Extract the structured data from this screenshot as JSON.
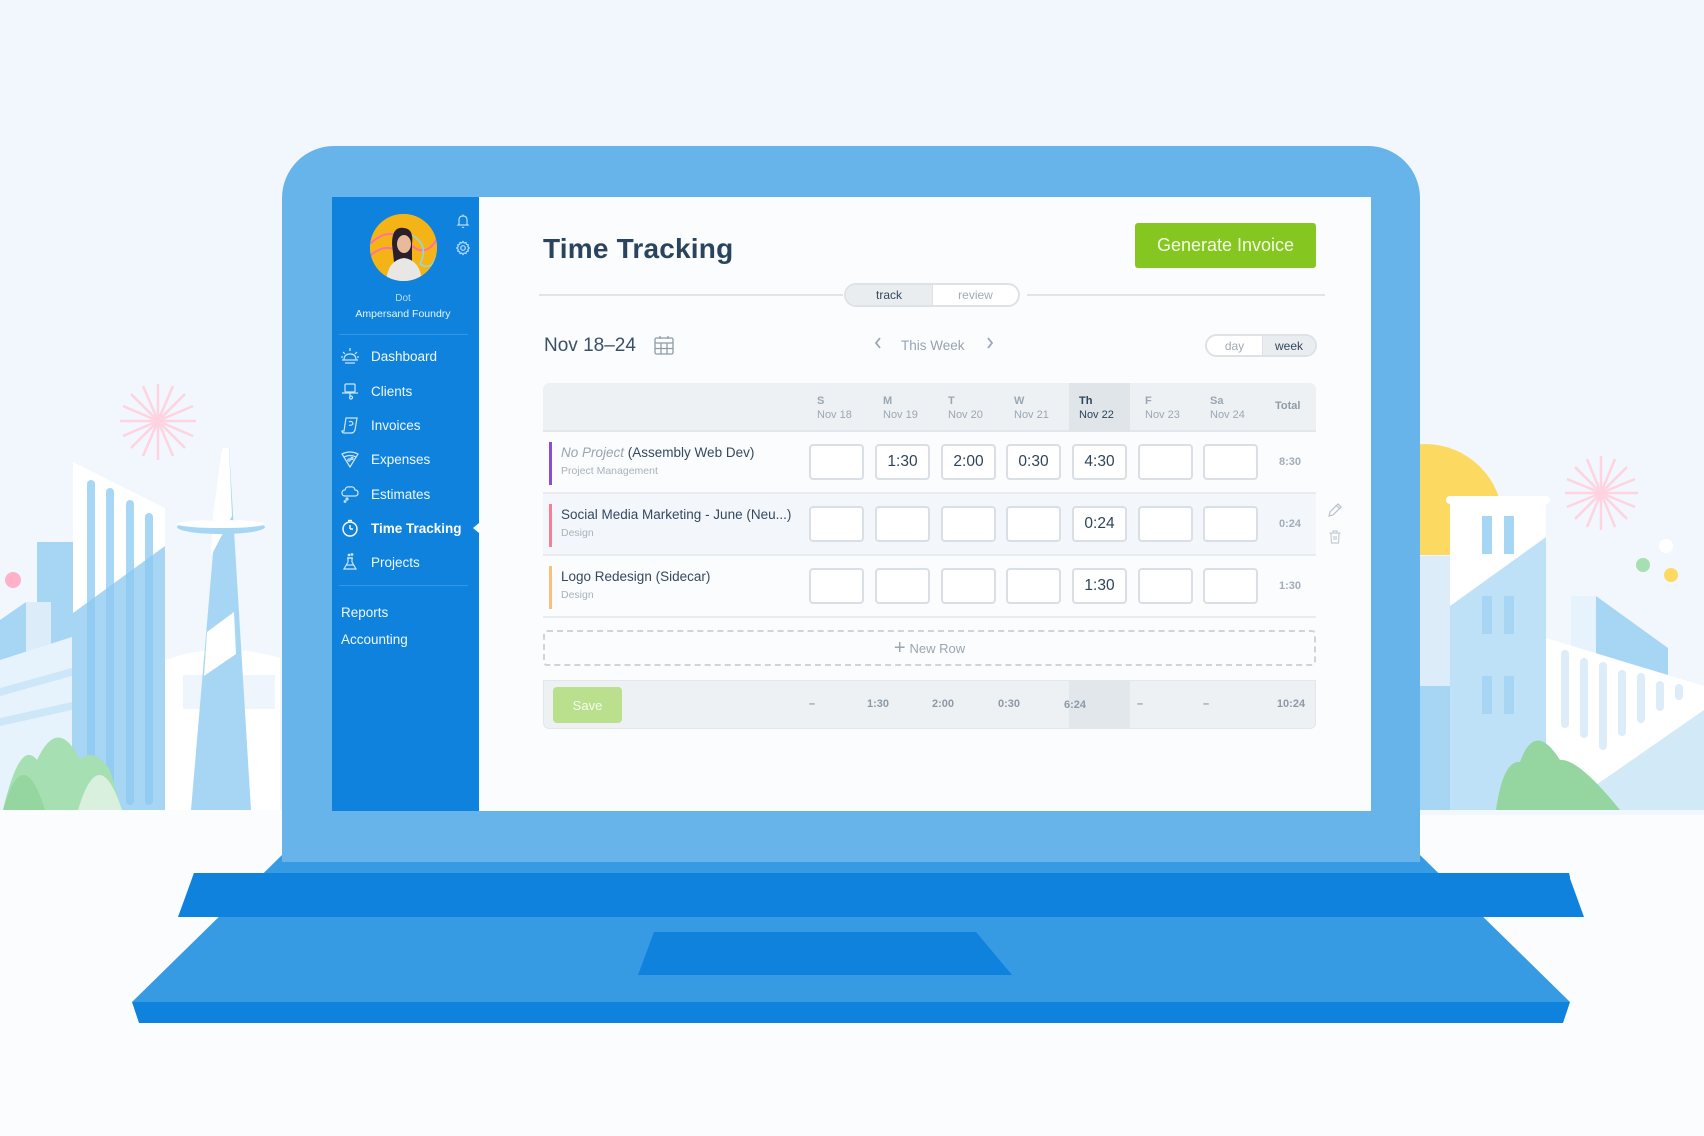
{
  "colors": {
    "sidebar_bg": "#0f82de",
    "accent_green": "#85c621",
    "save_green_disabled": "#badf8d",
    "laptop_lid": "#67b4eb",
    "title_text": "#2b445e"
  },
  "sidebar": {
    "user": {
      "name": "Dot",
      "organization": "Ampersand Foundry"
    },
    "top_icons": [
      {
        "icon": "bell-icon"
      },
      {
        "icon": "gear-icon"
      }
    ],
    "nav": [
      {
        "label": "Dashboard",
        "icon": "sunrise-icon",
        "active": false
      },
      {
        "label": "Clients",
        "icon": "hat-icon",
        "active": false
      },
      {
        "label": "Invoices",
        "icon": "scroll-icon",
        "active": false
      },
      {
        "label": "Expenses",
        "icon": "pizza-icon",
        "active": false
      },
      {
        "label": "Estimates",
        "icon": "cloud-icon",
        "active": false
      },
      {
        "label": "Time Tracking",
        "icon": "stopwatch-icon",
        "active": true
      },
      {
        "label": "Projects",
        "icon": "flask-icon",
        "active": false
      }
    ],
    "secondary": [
      {
        "label": "Reports"
      },
      {
        "label": "Accounting"
      }
    ]
  },
  "header": {
    "title": "Time Tracking",
    "generate_invoice_label": "Generate Invoice"
  },
  "mode_toggle": {
    "options": [
      "track",
      "review"
    ],
    "selected": "track"
  },
  "date_bar": {
    "range": "Nov 18–24",
    "period_label": "This Week",
    "view_toggle": {
      "options": [
        "day",
        "week"
      ],
      "selected": "week"
    }
  },
  "table": {
    "days": [
      {
        "abbr": "S",
        "date": "Nov 18",
        "today": false
      },
      {
        "abbr": "M",
        "date": "Nov 19",
        "today": false
      },
      {
        "abbr": "T",
        "date": "Nov 20",
        "today": false
      },
      {
        "abbr": "W",
        "date": "Nov 21",
        "today": false
      },
      {
        "abbr": "Th",
        "date": "Nov 22",
        "today": true
      },
      {
        "abbr": "F",
        "date": "Nov 23",
        "today": false
      },
      {
        "abbr": "Sa",
        "date": "Nov 24",
        "today": false
      }
    ],
    "total_header": "Total",
    "rows": [
      {
        "prefix": "No Project",
        "name": "(Assembly Web Dev)",
        "task": "Project Management",
        "color": "#8a4fd0",
        "hours": [
          "",
          "1:30",
          "2:00",
          "0:30",
          "4:30",
          "",
          ""
        ],
        "total": "8:30"
      },
      {
        "prefix": "",
        "name": "Social Media Marketing - June (Neu...)",
        "task": "Design",
        "color": "#f47f97",
        "hours": [
          "",
          "",
          "",
          "",
          "0:24",
          "",
          ""
        ],
        "total": "0:24"
      },
      {
        "prefix": "",
        "name": "Logo Redesign (Sidecar)",
        "task": "Design",
        "color": "#f7c07f",
        "hours": [
          "",
          "",
          "",
          "",
          "1:30",
          "",
          ""
        ],
        "total": "1:30"
      }
    ],
    "new_row_label": "New Row",
    "save_label": "Save",
    "day_totals": [
      "–",
      "1:30",
      "2:00",
      "0:30",
      "6:24",
      "–",
      "–"
    ],
    "grand_total": "10:24"
  },
  "row_tools": [
    {
      "icon": "pencil-icon"
    },
    {
      "icon": "trash-icon"
    }
  ]
}
